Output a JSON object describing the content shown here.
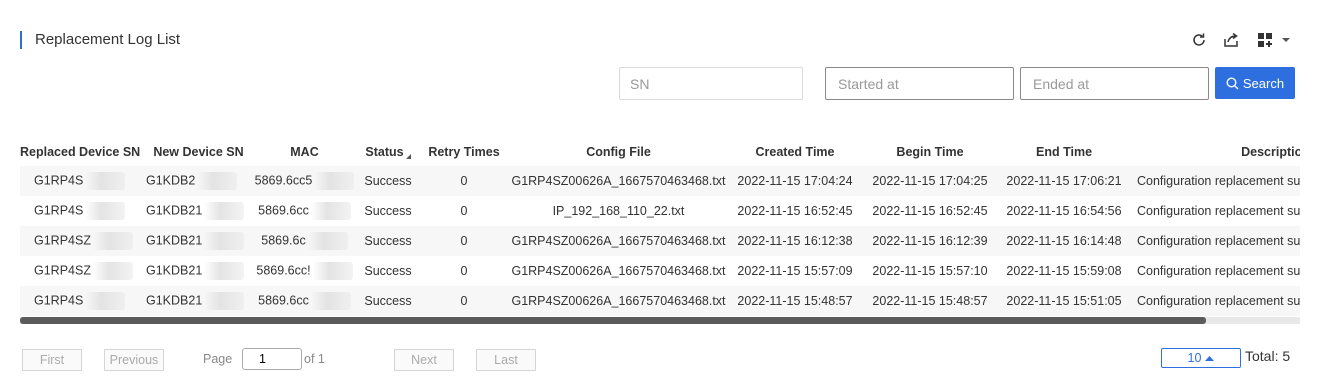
{
  "header": {
    "title": "Replacement Log List",
    "icons": [
      "refresh-icon",
      "export-icon",
      "grid-add-icon",
      "caret-down-icon"
    ]
  },
  "filters": {
    "sn_placeholder": "SN",
    "started_placeholder": "Started at",
    "ended_placeholder": "Ended at",
    "search_label": "Search"
  },
  "table": {
    "columns": [
      "Replaced Device SN",
      "New Device SN",
      "MAC",
      "Status",
      "Retry Times",
      "Config File",
      "Created Time",
      "Begin Time",
      "End Time",
      "Description"
    ],
    "rows": [
      {
        "replaced_sn": "G1RP4S",
        "new_sn": "G1KDB2",
        "mac": "5869.6cc5",
        "status": "Success",
        "retry": "0",
        "config": "G1RP4SZ00626A_1667570463468.txt",
        "created": "2022-11-15 17:04:24",
        "begin": "2022-11-15 17:04:25",
        "end": "2022-11-15 17:06:21",
        "desc": "Configuration replacement su"
      },
      {
        "replaced_sn": "G1RP4S",
        "new_sn": "G1KDB21",
        "mac": "5869.6cc",
        "status": "Success",
        "retry": "0",
        "config": "IP_192_168_110_22.txt",
        "created": "2022-11-15 16:52:45",
        "begin": "2022-11-15 16:52:45",
        "end": "2022-11-15 16:54:56",
        "desc": "Configuration replacement su"
      },
      {
        "replaced_sn": "G1RP4SZ",
        "new_sn": "G1KDB21",
        "mac": "5869.6c",
        "status": "Success",
        "retry": "0",
        "config": "G1RP4SZ00626A_1667570463468.txt",
        "created": "2022-11-15 16:12:38",
        "begin": "2022-11-15 16:12:39",
        "end": "2022-11-15 16:14:48",
        "desc": "Configuration replacement su"
      },
      {
        "replaced_sn": "G1RP4SZ",
        "new_sn": "G1KDB21",
        "mac": "5869.6cc!",
        "status": "Success",
        "retry": "0",
        "config": "G1RP4SZ00626A_1667570463468.txt",
        "created": "2022-11-15 15:57:09",
        "begin": "2022-11-15 15:57:10",
        "end": "2022-11-15 15:59:08",
        "desc": "Configuration replacement su"
      },
      {
        "replaced_sn": "G1RP4S",
        "new_sn": "G1KDB21",
        "mac": "5869.6cc",
        "status": "Success",
        "retry": "0",
        "config": "G1RP4SZ00626A_1667570463468.txt",
        "created": "2022-11-15 15:48:57",
        "begin": "2022-11-15 15:48:57",
        "end": "2022-11-15 15:51:05",
        "desc": "Configuration replacement su"
      }
    ]
  },
  "pagination": {
    "first": "First",
    "previous": "Previous",
    "page_label": "Page",
    "current_page": "1",
    "of_label": "of 1",
    "next": "Next",
    "last": "Last",
    "page_size": "10",
    "total": "Total: 5"
  },
  "colors": {
    "accent": "#2e6fe0",
    "title_bar": "#2e6bd6",
    "scrollbar_thumb": "#5b5b5b"
  }
}
